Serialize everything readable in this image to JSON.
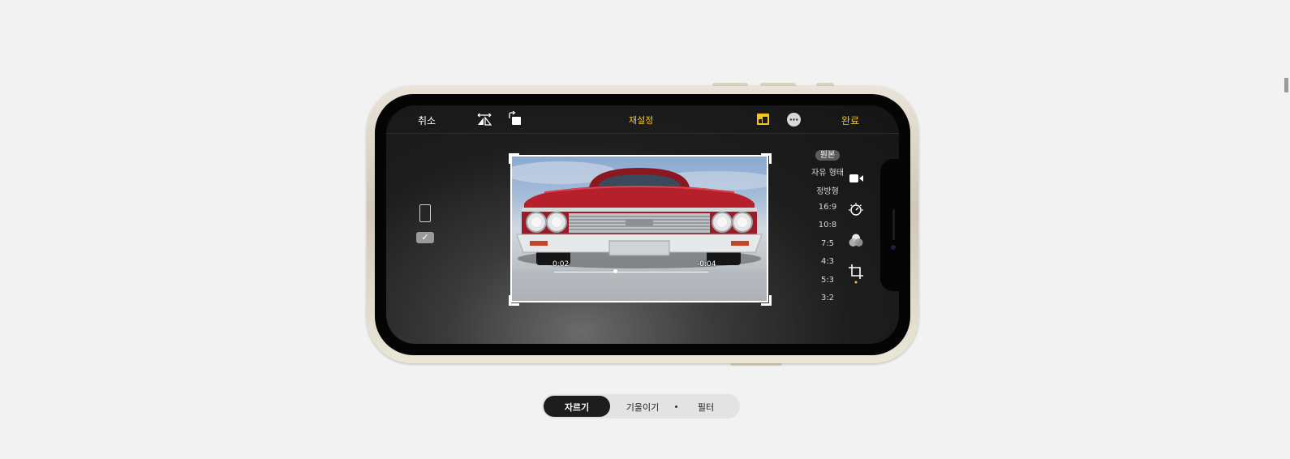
{
  "editor": {
    "cancel": "취소",
    "reset": "재설정",
    "done": "완료",
    "icons": [
      "flip-horizontal-icon",
      "rotate-icon",
      "aspect-ratio-icon",
      "more-icon"
    ]
  },
  "video": {
    "time_elapsed": "0:02",
    "time_remaining": "-0:04",
    "scrub_position": 0.39
  },
  "aspect_ratios": {
    "selected": "원본",
    "items": [
      "원본",
      "자유 형태",
      "정방형",
      "16:9",
      "10:8",
      "7:5",
      "4:3",
      "5:3",
      "3:2"
    ]
  },
  "orientation": {
    "check": "✓"
  },
  "tools": [
    "video-icon",
    "adjust-icon",
    "filters-icon",
    "crop-icon"
  ],
  "segmented": {
    "active": "자르기",
    "items": [
      "자르기",
      "기울이기",
      "필터"
    ]
  },
  "colors": {
    "accent": "#f5c518",
    "car_red": "#b5202c",
    "segment_active": "#1d1d1f"
  }
}
